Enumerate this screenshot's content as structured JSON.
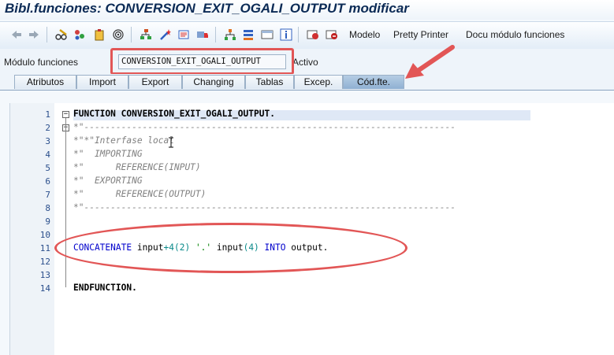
{
  "window": {
    "title": "Bibl.funciones: CONVERSION_EXIT_OGALI_OUTPUT modificar"
  },
  "toolbar": {
    "icons": [
      "back-arrow-icon",
      "forward-arrow-icon",
      "glasses-pencil-icon",
      "flowers-icon",
      "clipboard-icon",
      "spiral-icon",
      "hierarchy-icon",
      "magic-wand-icon",
      "printer-list-icon",
      "transport-icon",
      "tree-icon",
      "stack-icon",
      "window-icon",
      "info-icon",
      "insert-icon",
      "utilities-icon"
    ],
    "buttons": [
      "Modelo",
      "Pretty Printer",
      "Docu módulo funciones"
    ]
  },
  "module": {
    "label": "Módulo funciones",
    "value": "CONVERSION_EXIT_OGALI_OUTPUT",
    "status": "Activo"
  },
  "tabs": [
    "Atributos",
    "Import",
    "Export",
    "Changing",
    "Tablas",
    "Excep.",
    "Cód.fte."
  ],
  "active_tab": "Cód.fte.",
  "accent": {
    "annotation": "#e25656",
    "active_tab": "#9db9d8"
  },
  "editor": {
    "line_numbers": [
      "1",
      "2",
      "3",
      "4",
      "5",
      "6",
      "7",
      "8",
      "9",
      "10",
      "11",
      "12",
      "13",
      "14"
    ],
    "lines": {
      "l1_kw": "FUNCTION",
      "l1_rest": " CONVERSION_EXIT_OGALI_OUTPUT.",
      "l2": "*\"----------------------------------------------------------------------",
      "l3": "*\"*\"Interfase local",
      "l4": "*\"  IMPORTING",
      "l5": "*\"      REFERENCE(INPUT)",
      "l6": "*\"  EXPORTING",
      "l7": "*\"      REFERENCE(OUTPUT)",
      "l8": "*\"----------------------------------------------------------------------",
      "l11": {
        "kw1": "CONCATENATE",
        "a": " input",
        "n1": "+4(2)",
        "s": " '.'",
        "b": " input",
        "n2": "(4)",
        "kw2": " INTO",
        "c": " output."
      },
      "l14": "ENDFUNCTION."
    }
  }
}
